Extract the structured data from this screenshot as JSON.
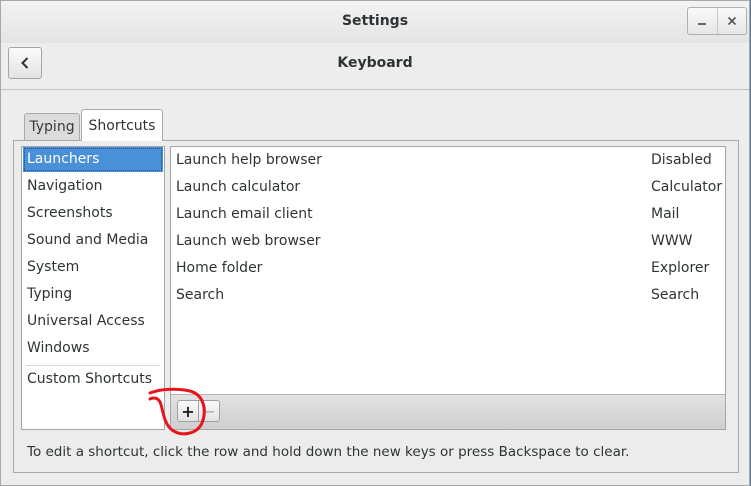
{
  "window": {
    "title": "Settings",
    "controls": {
      "minimize_icon": "minimize-icon",
      "close_icon": "close-icon"
    }
  },
  "toolbar": {
    "back_icon": "chevron-left-icon",
    "page_title": "Keyboard"
  },
  "tabs": [
    {
      "label": "Typing",
      "active": false
    },
    {
      "label": "Shortcuts",
      "active": true
    }
  ],
  "categories": [
    {
      "label": "Launchers",
      "selected": true
    },
    {
      "label": "Navigation",
      "selected": false
    },
    {
      "label": "Screenshots",
      "selected": false
    },
    {
      "label": "Sound and Media",
      "selected": false
    },
    {
      "label": "System",
      "selected": false
    },
    {
      "label": "Typing",
      "selected": false
    },
    {
      "label": "Universal Access",
      "selected": false
    },
    {
      "label": "Windows",
      "selected": false
    },
    {
      "label": "Custom Shortcuts",
      "selected": false
    }
  ],
  "shortcuts": [
    {
      "name": "Launch help browser",
      "accel": "Disabled"
    },
    {
      "name": "Launch calculator",
      "accel": "Calculator"
    },
    {
      "name": "Launch email client",
      "accel": "Mail"
    },
    {
      "name": "Launch web browser",
      "accel": "WWW"
    },
    {
      "name": "Home folder",
      "accel": "Explorer"
    },
    {
      "name": "Search",
      "accel": "Search"
    }
  ],
  "list_buttons": {
    "add": "+",
    "remove": "−"
  },
  "hint": "To edit a shortcut, click the row and hold down the new keys or press Backspace to clear.",
  "colors": {
    "selection": "#4a90d9",
    "annotation": "#e8141b"
  }
}
